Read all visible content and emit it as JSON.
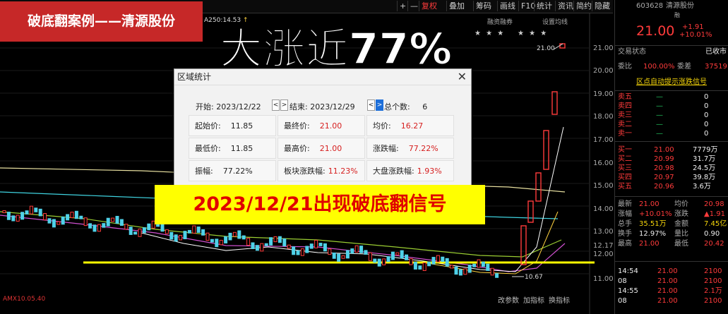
{
  "banner": {
    "title": "破底翻案例——清源股份"
  },
  "headline": "大涨近77%",
  "signal_text": "2023/12/21出现破底翻信号",
  "toolbar": {
    "buttons": [
      "+",
      "—",
      "复权",
      "叠加",
      "筹码",
      "画线",
      "F10",
      "统计",
      "资讯",
      "简约",
      "隐藏"
    ],
    "active_button": "复权",
    "ma_label": "A250:14.53",
    "arrow": "↑",
    "sub_labels": [
      "融资融券",
      "设置均线"
    ]
  },
  "stars": "★ ★ ★",
  "price_ticks": [
    "21.00",
    "20.00",
    "19.00",
    "18.00",
    "17.00",
    "16.00",
    "15.00",
    "14.00",
    "13.00",
    "12.17",
    "12.00",
    "11.00"
  ],
  "chart_annotations": {
    "high": "21.00",
    "low": "10.67"
  },
  "bottom_labels": [
    "改参数",
    "加指标",
    "换指标"
  ],
  "bottom_left": "AMX10.05.40",
  "dialog": {
    "title": "区域统计",
    "close": "✕",
    "start_label": "开始:",
    "start_value": "2023/12/22",
    "end_label": "结束:",
    "end_value": "2023/12/29",
    "count_label": "总个数:",
    "count_value": "6",
    "nav_left": "<",
    "nav_right": ">",
    "cells": [
      {
        "label": "起始价:",
        "value": "11.85",
        "red": false
      },
      {
        "label": "最终价:",
        "value": "21.00",
        "red": true
      },
      {
        "label": "均价:",
        "value": "16.27",
        "red": true
      },
      {
        "label": "最低价:",
        "value": "11.85",
        "red": false
      },
      {
        "label": "最高价:",
        "value": "21.00",
        "red": true
      },
      {
        "label": "涨跌幅:",
        "value": "77.22%",
        "red": true
      },
      {
        "label": "振幅:",
        "value": "77.22%",
        "red": false
      },
      {
        "label": "板块涨跌幅:",
        "value": "11.23%",
        "red": true
      },
      {
        "label": "大盘涨跌幅:",
        "value": "1.93%",
        "red": true
      }
    ]
  },
  "right_panel": {
    "code": "603628",
    "name": "清源股份",
    "tag": "融",
    "price": "21.00",
    "change": "+1.91",
    "change_pct": "+10.01%",
    "status_label": "交易状态",
    "status_value": "已收市",
    "weibi_label": "委比",
    "weibi_value": "100.00%",
    "weicha_label": "委差",
    "weicha_value": "37519",
    "alert_text": "区点自动提示涨跌信号",
    "asks": [
      {
        "label": "卖五",
        "price": "—",
        "vol": "0"
      },
      {
        "label": "卖四",
        "price": "—",
        "vol": "0"
      },
      {
        "label": "卖三",
        "price": "—",
        "vol": "0"
      },
      {
        "label": "卖二",
        "price": "—",
        "vol": "0"
      },
      {
        "label": "卖一",
        "price": "—",
        "vol": "0"
      }
    ],
    "bids": [
      {
        "label": "买一",
        "price": "21.00",
        "vol": "7779万"
      },
      {
        "label": "买二",
        "price": "20.99",
        "vol": "31.7万"
      },
      {
        "label": "买三",
        "price": "20.98",
        "vol": "24.5万"
      },
      {
        "label": "买四",
        "price": "20.97",
        "vol": "39.8万"
      },
      {
        "label": "买五",
        "price": "20.96",
        "vol": "3.6万"
      }
    ],
    "stats": [
      {
        "l1": "最新",
        "v1": "21.00",
        "l2": "均价",
        "v2": "20.98"
      },
      {
        "l1": "涨幅",
        "v1": "+10.01%",
        "l2": "涨跌",
        "v2": "▲1.91"
      },
      {
        "l1": "总手",
        "v1": "35.51万",
        "l2": "金额",
        "v2": "7.45亿"
      },
      {
        "l1": "换手",
        "v1": "12.97%",
        "l2": "量比",
        "v2": "0.90"
      },
      {
        "l1": "最高",
        "v1": "21.00",
        "l2": "最低",
        "v2": "20.42"
      }
    ],
    "ticks": [
      {
        "time": "14:54",
        "price": "21.00",
        "vol": "2100"
      },
      {
        "time": "08",
        "price": "21.00",
        "vol": "2100"
      },
      {
        "time": "14:55",
        "price": "21.00",
        "vol": "2.1万"
      },
      {
        "time": "08",
        "price": "21.00",
        "vol": "2100"
      }
    ]
  },
  "colors": {
    "up": "#ff3b3b",
    "down": "#22c55e",
    "banner": "#c62828",
    "signal_bg": "#ffff00"
  }
}
